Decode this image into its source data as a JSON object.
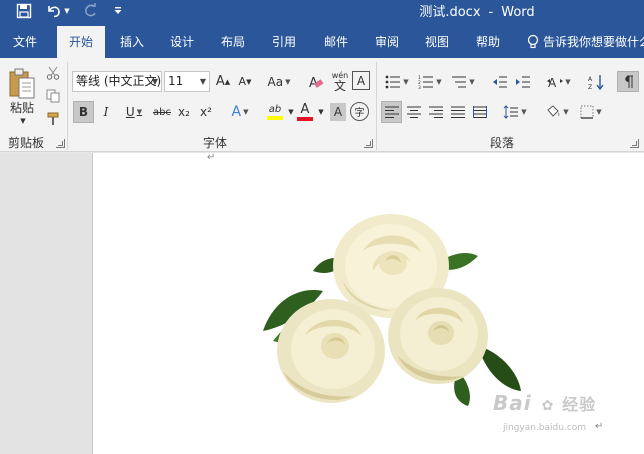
{
  "window": {
    "title": "测试.docx",
    "separator": "-",
    "app_name": "Word"
  },
  "quick_access": [
    "save-icon",
    "undo-icon",
    "redo-icon",
    "customize-icon"
  ],
  "tabs": [
    "文件",
    "开始",
    "插入",
    "设计",
    "布局",
    "引用",
    "邮件",
    "审阅",
    "视图",
    "帮助"
  ],
  "active_tab": "开始",
  "tell_me": "告诉我你想要做什么",
  "clipboard": {
    "paste_label": "粘贴",
    "group_label": "剪贴板"
  },
  "font": {
    "font_name": "等线 (中文正文)",
    "font_size": "11",
    "grow_label": "A",
    "shrink_label": "A",
    "case_label": "Aa",
    "pinyin_label": "wén",
    "pinyin_char": "文",
    "border_char": "A",
    "bold": "B",
    "italic": "I",
    "underline": "U",
    "strike": "abc",
    "subscript": "x₂",
    "superscript": "x²",
    "effects": "A",
    "highlight": "ab",
    "color": "A",
    "shade": "A",
    "enclose": "字",
    "group_label": "字体"
  },
  "paragraph": {
    "group_label": "段落"
  },
  "document": {
    "paragraph_mark": "↵",
    "watermark_main": "Bai",
    "watermark_sub": "经验",
    "watermark_url": "jingyan.baidu.com"
  },
  "colors": {
    "ribbon_blue": "#2b579a",
    "highlight_yellow": "#ffff00",
    "font_red": "#e81123"
  }
}
